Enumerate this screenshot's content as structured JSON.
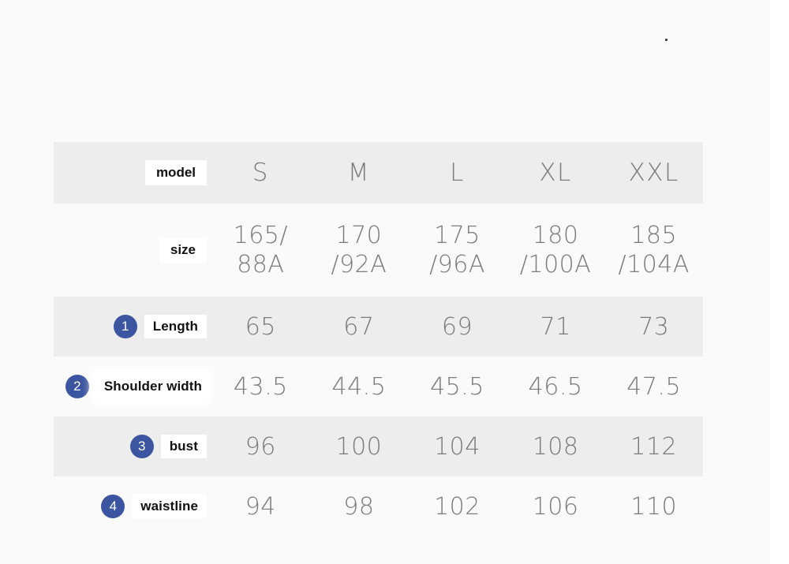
{
  "table": {
    "header": {
      "label": "model",
      "sizes": [
        "S",
        "M",
        "L",
        "XL",
        "XXL"
      ]
    },
    "size_row": {
      "label": "size",
      "values": [
        {
          "line1": "165/",
          "line2": "88A"
        },
        {
          "line1": "170",
          "line2": "/92A"
        },
        {
          "line1": "175",
          "line2": "/96A"
        },
        {
          "line1": "180",
          "line2": "/100A"
        },
        {
          "line1": "185",
          "line2": "/104A"
        }
      ]
    },
    "measurements": [
      {
        "index": "1",
        "label": "Length",
        "values": [
          "65",
          "67",
          "69",
          "71",
          "73"
        ]
      },
      {
        "index": "2",
        "label": "Shoulder width",
        "values": [
          "43.5",
          "44.5",
          "45.5",
          "46.5",
          "47.5"
        ]
      },
      {
        "index": "3",
        "label": "bust",
        "values": [
          "96",
          "100",
          "104",
          "108",
          "112"
        ]
      },
      {
        "index": "4",
        "label": "waistline",
        "values": [
          "94",
          "98",
          "102",
          "106",
          "110"
        ]
      }
    ]
  },
  "colors": {
    "badge": "#3b55a0",
    "shaded_row": "#ededed",
    "page_background": "#fafafa",
    "data_text": "#7b7b7b",
    "label_text": "#111111"
  }
}
